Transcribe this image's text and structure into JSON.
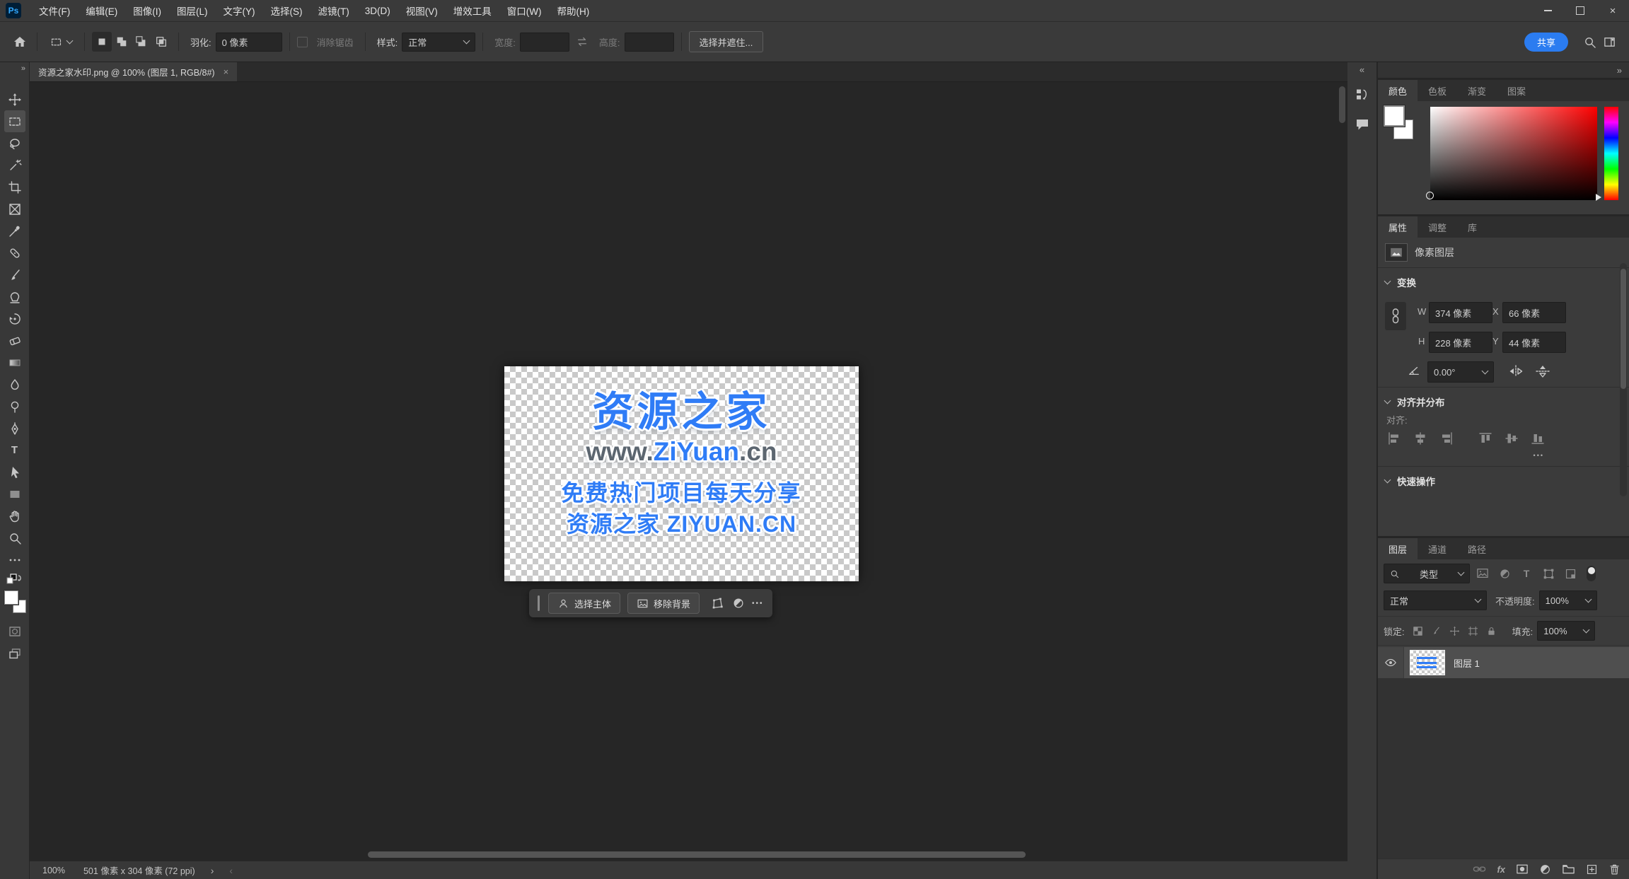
{
  "colors": {
    "accent_blue": "#2b7cf0",
    "watermark_blue": "#2f7cf6",
    "watermark_gray": "#5c6670",
    "watermark_green": "#2fd8a0",
    "ps_logo_blue": "#31a8ff",
    "ps_logo_bg": "#001e36"
  },
  "glyphs": {
    "ps": "Ps",
    "close": "×",
    "ellipsis": "•••",
    "double_left": "«",
    "double_right": "»",
    "chevron_right": "›",
    "chevron_left": "‹",
    "fx": "fx",
    "type_tool": "T"
  },
  "titlebar": {
    "menus": [
      "文件(F)",
      "编辑(E)",
      "图像(I)",
      "图层(L)",
      "文字(Y)",
      "选择(S)",
      "滤镜(T)",
      "3D(D)",
      "视图(V)",
      "增效工具",
      "窗口(W)",
      "帮助(H)"
    ]
  },
  "options_bar": {
    "feather_label": "羽化:",
    "feather_value": "0 像素",
    "anti_alias_label": "消除锯齿",
    "style_label": "样式:",
    "style_value": "正常",
    "width_label": "宽度:",
    "width_value": "",
    "height_label": "高度:",
    "height_value": "",
    "select_and_mask": "选择并遮住...",
    "share": "共享"
  },
  "document_tab": {
    "title": "资源之家水印.png @ 100% (图层 1, RGB/8#)"
  },
  "watermark": {
    "line1": "资源之家",
    "line2_prefix": "www.",
    "line2_main": "ZiYuan",
    "line2_suffix": ".cn",
    "line3": "免费热门项目每天分享",
    "line4": "资源之家 ZIYUAN.CN"
  },
  "task_bar": {
    "select_subject": "选择主体",
    "remove_background": "移除背景"
  },
  "color_panel": {
    "tabs": [
      "颜色",
      "色板",
      "渐变",
      "图案"
    ]
  },
  "properties_panel": {
    "tabs": [
      "属性",
      "调整",
      "库"
    ],
    "layer_type": "像素图层",
    "transform_title": "变换",
    "w_label": "W",
    "w_value": "374 像素",
    "x_label": "X",
    "x_value": "66 像素",
    "h_label": "H",
    "h_value": "228 像素",
    "y_label": "Y",
    "y_value": "44 像素",
    "angle_value": "0.00°",
    "align_title": "对齐并分布",
    "align_label": "对齐:",
    "quick_actions_title": "快速操作"
  },
  "layers_panel": {
    "tabs": [
      "图层",
      "通道",
      "路径"
    ],
    "filter_value": "类型",
    "blend_mode": "正常",
    "opacity_label": "不透明度:",
    "opacity_value": "100%",
    "lock_label": "锁定:",
    "fill_label": "填充:",
    "fill_value": "100%",
    "layer_name": "图层 1"
  },
  "status_bar": {
    "zoom": "100%",
    "doc_info": "501 像素 x 304 像素 (72 ppi)"
  }
}
